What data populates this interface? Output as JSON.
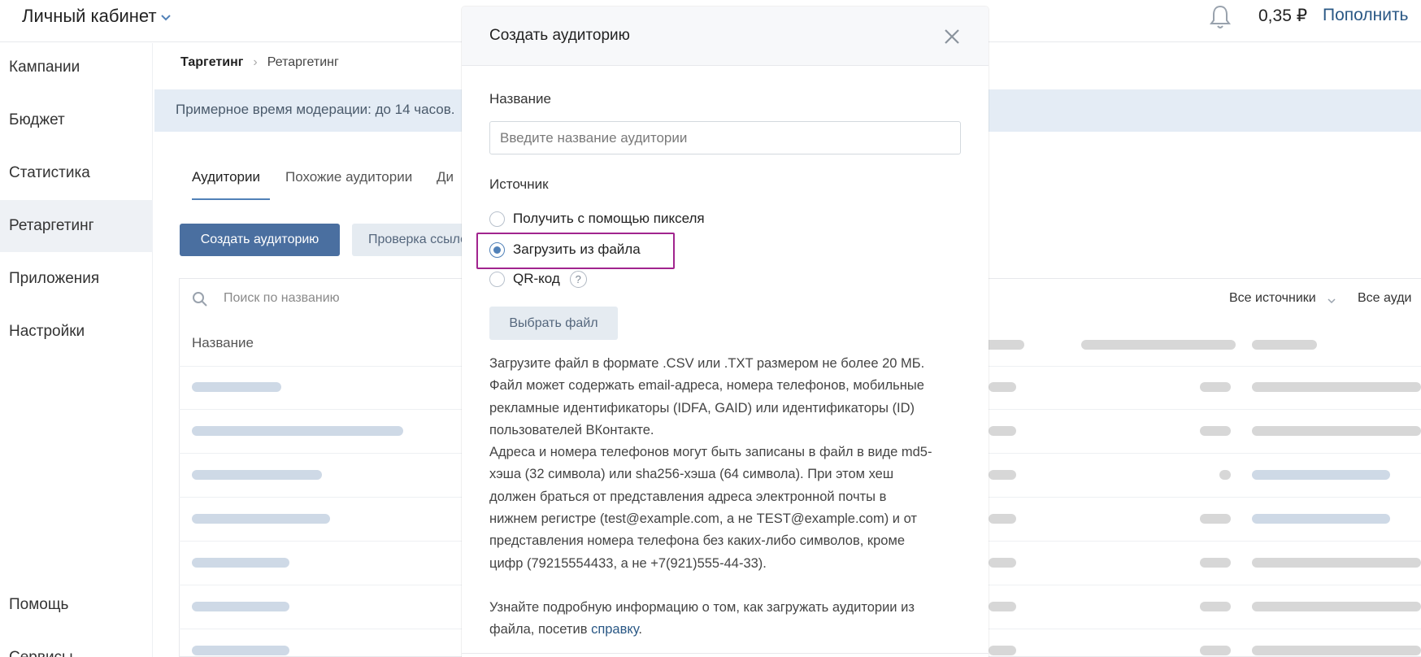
{
  "header": {
    "cabinet_title": "Личный кабинет",
    "balance": "0,35 ₽",
    "topup_label": "Пополнить"
  },
  "sidebar": {
    "items": [
      {
        "label": "Кампании"
      },
      {
        "label": "Бюджет"
      },
      {
        "label": "Статистика"
      },
      {
        "label": "Ретаргетинг",
        "active": true
      },
      {
        "label": "Приложения"
      },
      {
        "label": "Настройки"
      }
    ],
    "bottom_items": [
      {
        "label": "Помощь"
      },
      {
        "label": "Сервисы"
      }
    ]
  },
  "breadcrumb": {
    "items": [
      "Таргетинг",
      "Ретаргетинг"
    ]
  },
  "notice": {
    "text": "Примерное время модерации: до 14 часов."
  },
  "tabs": [
    {
      "label": "Аудитории",
      "active": true
    },
    {
      "label": "Похожие аудитории"
    },
    {
      "label": "Ди"
    }
  ],
  "toolbar": {
    "create_label": "Создать аудиторию",
    "check_label": "Проверка ссылок"
  },
  "table": {
    "search_placeholder": "Поиск по названию",
    "filter_sources": "Все источники",
    "filter_audiences": "Все ауди",
    "col_name": "Название"
  },
  "modal": {
    "title": "Создать аудиторию",
    "name_label": "Название",
    "name_placeholder": "Введите название аудитории",
    "name_value": "",
    "source_label": "Источник",
    "sources": [
      {
        "label": "Получить с помощью пикселя",
        "checked": false
      },
      {
        "label": "Загрузить из файла",
        "checked": true
      },
      {
        "label": "QR-код",
        "checked": false,
        "help": "?"
      }
    ],
    "choose_file_label": "Выбрать файл",
    "desc_lines": [
      "Загрузите файл в формате .CSV или .TXT размером не более 20 МБ.",
      "Файл может содержать email-адреса, номера телефонов, мобильные",
      "рекламные идентификаторы (IDFA, GAID) или идентификаторы (ID)",
      "пользователей ВКонтакте.",
      "Адреса и номера телефонов могут быть записаны в файл в виде md5-",
      "хэша (32 символа) или sha256-хэша (64 символа). При этом хеш",
      "должен браться от представления адреса электронной почты в",
      "нижнем регистре (test@example.com, а не TEST@example.com) и от",
      "представления номера телефона без каких-либо символов, кроме",
      "цифр (79215554433, а не +7(921)555-44-33)."
    ],
    "info_line1": "Узнайте подробную информацию о том, как загружать аудитории из",
    "info_line2_prefix": "файла, посетив ",
    "info_link": "справку",
    "info_line2_suffix": "."
  },
  "colors": {
    "accent": "#5181b8",
    "primary_button": "#4a6fa0",
    "link": "#2a5885",
    "highlight": "#a1248e",
    "notice_bg": "#e4ecf5"
  }
}
